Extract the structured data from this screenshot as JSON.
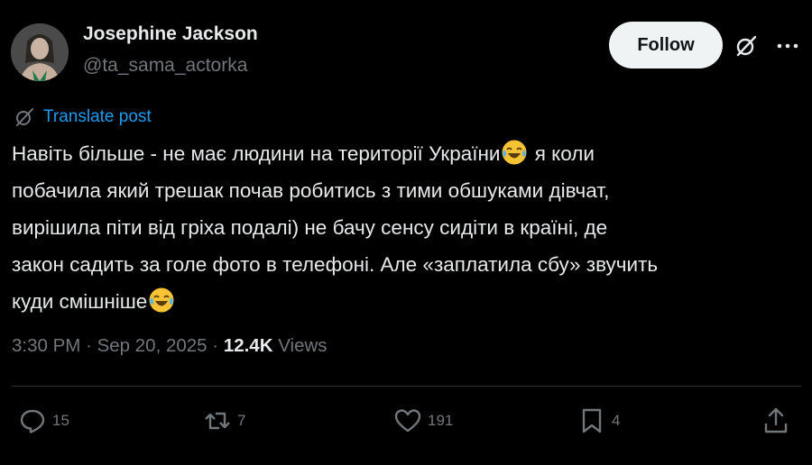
{
  "author": {
    "name": "Josephine Jackson",
    "handle": "@ta_sama_actorka"
  },
  "header": {
    "follow_label": "Follow",
    "grok_icon": "grok-icon",
    "more_icon": "more-dots-icon"
  },
  "translate": {
    "icon": "grok-icon",
    "label": "Translate post"
  },
  "post": {
    "lines": [
      {
        "text": "Навіть більше - не має людини на території України",
        "after_emoji": " я коли"
      },
      {
        "text": "побачила який трешак почав робитись з тими обшуками дівчат,"
      },
      {
        "text": "вирішила піти від гріха подалі) не бачу сенсу сидіти в країні, де"
      },
      {
        "text": "закон садить за голе фото в телефоні. Але «заплатила сбу» звучить"
      },
      {
        "text": "куди смішніше"
      }
    ],
    "emoji": "😂"
  },
  "meta": {
    "time": "3:30 PM",
    "separator": "·",
    "date": "Sep 20, 2025",
    "views_count": "12.4K",
    "views_label": "Views"
  },
  "actions": {
    "replies": "15",
    "reposts": "7",
    "likes": "191",
    "bookmarks": "4"
  },
  "colors": {
    "background": "#000000",
    "text": "#e7e9ea",
    "secondary": "#71767b",
    "link": "#1d9bf0",
    "divider": "#2f3336",
    "follow_bg": "#eff3f4"
  }
}
